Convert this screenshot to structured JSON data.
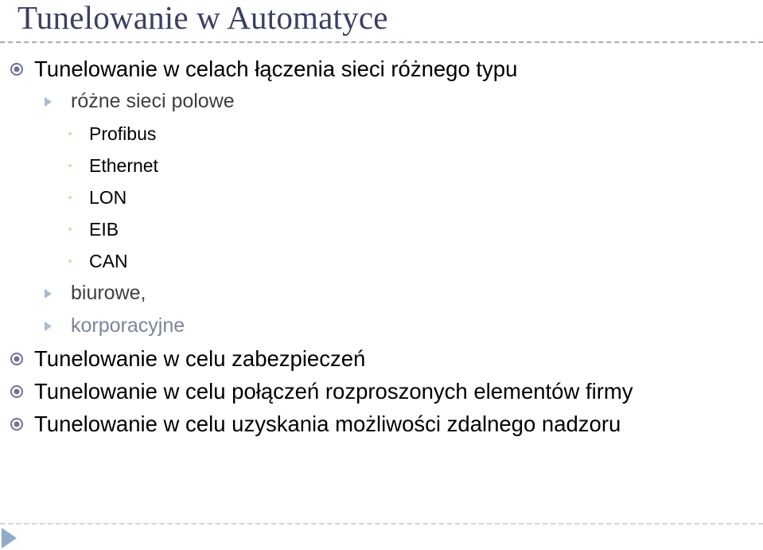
{
  "slide": {
    "title": "Tunelowanie w Automatyce",
    "title_color": "#3b4062",
    "background_color": "#ffffff",
    "accent_marker_color": "#6d7597",
    "triangle_marker_color": "#a7bdd3",
    "dot_marker_color": "#ddddaf",
    "nav_marker_color": "#8eacc9",
    "bullets": [
      {
        "level": 1,
        "marker": "target-dot-icon",
        "text": "Tunelowanie w celach łączenia sieci różnego typu"
      },
      {
        "level": 2,
        "marker": "triangle-icon",
        "text": "różne sieci polowe"
      },
      {
        "level": 3,
        "marker": "dot-icon",
        "text": "Profibus"
      },
      {
        "level": 3,
        "marker": "dot-icon",
        "text": "Ethernet"
      },
      {
        "level": 3,
        "marker": "dot-icon",
        "text": "LON"
      },
      {
        "level": 3,
        "marker": "dot-icon",
        "text": "EIB"
      },
      {
        "level": 3,
        "marker": "dot-icon",
        "text": "CAN"
      },
      {
        "level": 2,
        "marker": "triangle-icon",
        "text": "biurowe,"
      },
      {
        "level": 2,
        "marker": "triangle-icon",
        "text": "korporacyjne",
        "dim": true
      },
      {
        "level": 1,
        "marker": "target-dot-icon",
        "text": "Tunelowanie w celu zabezpieczeń"
      },
      {
        "level": 1,
        "marker": "target-dot-icon",
        "text": "Tunelowanie w celu połączeń rozproszonych elementów firmy"
      },
      {
        "level": 1,
        "marker": "target-dot-icon",
        "text": "Tunelowanie w celu uzyskania możliwości zdalnego nadzoru"
      }
    ]
  }
}
